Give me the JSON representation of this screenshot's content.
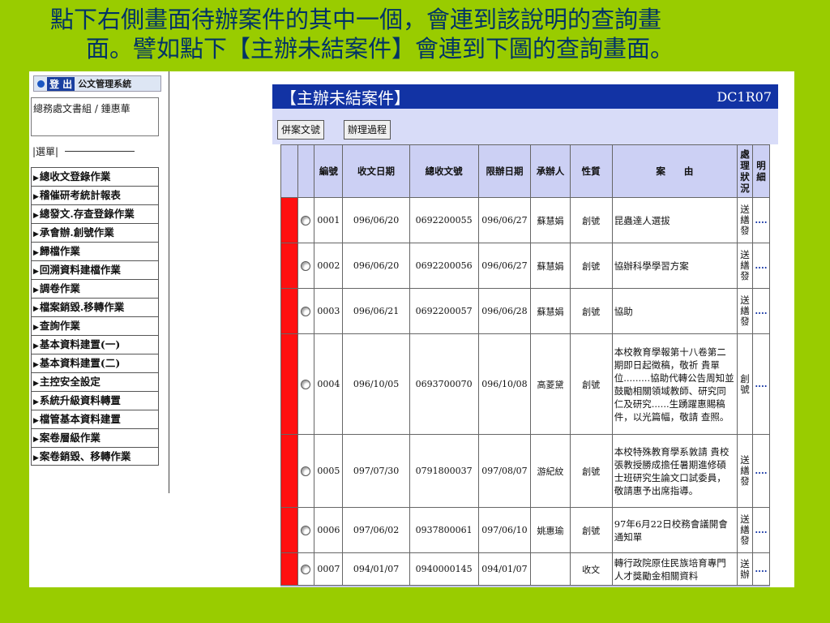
{
  "caption": {
    "line1": "點下右側畫面待辦案件的其中一個，會連到該說明的查詢畫",
    "line2": "面。譬如點下【主辦未結案件】會連到下圖的查詢畫面。"
  },
  "sidebar": {
    "logout_label": "登 出",
    "system_name": "公文管理系統",
    "user": "總務處文書組 / 鍾惠華",
    "menu_header": "|選單|",
    "items": [
      "總收文登錄作業",
      "稽催研考統計報表",
      "總發文.存查登錄作業",
      "承會辦.創號作業",
      "歸檔作業",
      "回溯資料建檔作業",
      "調卷作業",
      "檔案銷毀.移轉作業",
      "查詢作業",
      "基本資料建置(一)",
      "基本資料建置(二)",
      "主控安全設定",
      "系統升級資料轉置",
      "檔管基本資料建置",
      "案卷層級作業",
      "案卷銷毀、移轉作業"
    ]
  },
  "panel": {
    "title": "【主辦未結案件】",
    "code": "DC1R07",
    "buttons": [
      "併案文號",
      "辦理過程"
    ]
  },
  "table": {
    "headers": [
      "編號",
      "收文日期",
      "總收文號",
      "限辦日期",
      "承辦人",
      "性質",
      "案　　由",
      "處理狀況",
      "明細"
    ],
    "rows": [
      {
        "no": "0001",
        "date": "096/06/20",
        "docno": "0692200055",
        "due": "096/06/27",
        "handler": "蘇慧娟",
        "kind": "創號",
        "subject": "昆蟲達人選拔",
        "status": "送繕發",
        "detail": "...."
      },
      {
        "no": "0002",
        "date": "096/06/20",
        "docno": "0692200056",
        "due": "096/06/27",
        "handler": "蘇慧娟",
        "kind": "創號",
        "subject": "協辦科學學習方案",
        "status": "送繕發",
        "detail": "...."
      },
      {
        "no": "0003",
        "date": "096/06/21",
        "docno": "0692200057",
        "due": "096/06/28",
        "handler": "蘇慧娟",
        "kind": "創號",
        "subject": "協助",
        "status": "送繕發",
        "detail": "...."
      },
      {
        "no": "0004",
        "date": "096/10/05",
        "docno": "0693700070",
        "due": "096/10/08",
        "handler": "高菱黛",
        "kind": "創號",
        "subject": "本校教育學報第十八卷第二期即日起徵稿，敬祈 貴單位.........協助代轉公告周知並鼓勵相關領域教師、研究同仁及研究......生踴躍惠賜稿件，以光篇幅，敬請 查照。",
        "status": "創號",
        "detail": "...."
      },
      {
        "no": "0005",
        "date": "097/07/30",
        "docno": "0791800037",
        "due": "097/08/07",
        "handler": "游紀紋",
        "kind": "創號",
        "subject": "本校特殊教育學系敦請 貴校張教授勝成擔任暑期進修碩士班研究生論文口試委員，敬請惠予出席指導。",
        "status": "送繕發",
        "detail": "...."
      },
      {
        "no": "0006",
        "date": "097/06/02",
        "docno": "0937800061",
        "due": "097/06/10",
        "handler": "姚惠瑜",
        "kind": "創號",
        "subject": "97年6月22日校務會議開會通知單",
        "status": "送繕發",
        "detail": "...."
      },
      {
        "no": "0007",
        "date": "094/01/07",
        "docno": "0940000145",
        "due": "094/01/07",
        "handler": "",
        "kind": "收文",
        "subject": "轉行政院原住民族培育專門人才獎勵金相關資料",
        "status": "送辦",
        "detail": "...."
      }
    ]
  }
}
